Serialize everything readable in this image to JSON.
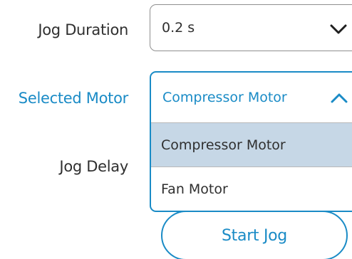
{
  "fields": {
    "jog_duration_label": "Jog Duration",
    "jog_duration_value": "0.2 s",
    "selected_motor_label": "Selected Motor",
    "selected_motor_value": "Compressor Motor",
    "jog_delay_label": "Jog Delay"
  },
  "motor_options": [
    {
      "label": "Compressor Motor",
      "selected": true
    },
    {
      "label": "Fan Motor",
      "selected": false
    }
  ],
  "actions": {
    "start_jog_label": "Start Jog"
  },
  "colors": {
    "accent": "#1a8bc6",
    "selected_option_bg": "#c6d7e6",
    "text": "#2f2f2f",
    "border": "#8f8f8f"
  },
  "icons": {
    "closed_dropdown": "chevron-down-icon",
    "open_dropdown": "chevron-up-icon"
  }
}
